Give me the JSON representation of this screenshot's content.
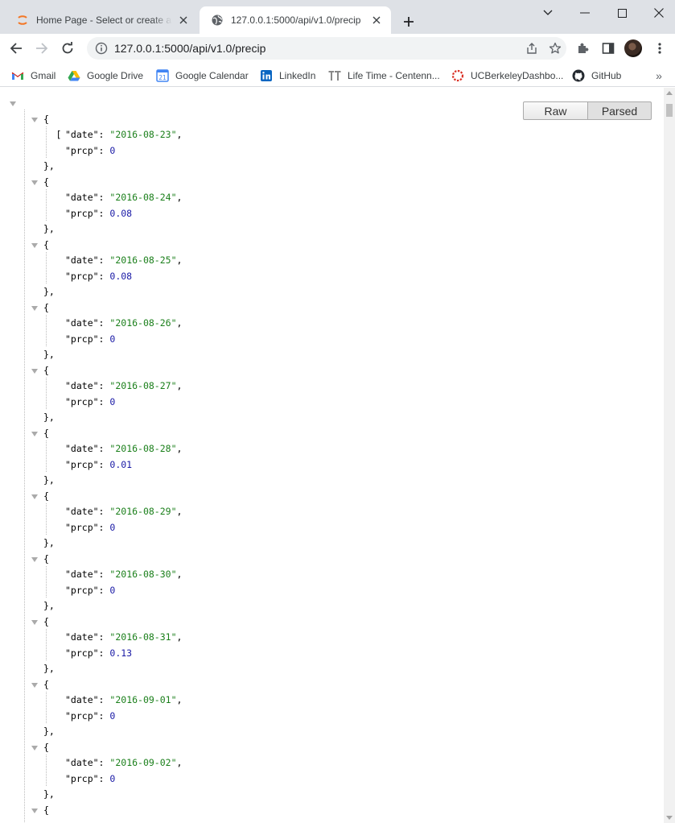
{
  "browser": {
    "tabs": [
      {
        "title": "Home Page - Select or create a notebook",
        "favicon": "jupyter-icon",
        "active": false
      },
      {
        "title": "127.0.0.1:5000/api/v1.0/precip",
        "favicon": "globe-icon",
        "active": true
      }
    ],
    "address_bar": {
      "url": "127.0.0.1:5000/api/v1.0/precip"
    },
    "bookmarks": [
      {
        "label": "Gmail",
        "icon": "gmail-icon"
      },
      {
        "label": "Google Drive",
        "icon": "google-drive-icon"
      },
      {
        "label": "Google Calendar",
        "icon": "google-calendar-icon",
        "icon_text": "21"
      },
      {
        "label": "LinkedIn",
        "icon": "linkedin-icon"
      },
      {
        "label": "Life Time - Centenn...",
        "icon": "lifetime-icon"
      },
      {
        "label": "UCBerkeleyDashbo...",
        "icon": "ucberkeley-icon"
      },
      {
        "label": "GitHub",
        "icon": "github-icon"
      }
    ],
    "bookmarks_overflow": "»"
  },
  "viewer": {
    "raw_label": "Raw",
    "parsed_label": "Parsed",
    "open_bracket": "[",
    "records": [
      {
        "date": "2016-08-23",
        "prcp": "0"
      },
      {
        "date": "2016-08-24",
        "prcp": "0.08"
      },
      {
        "date": "2016-08-25",
        "prcp": "0.08"
      },
      {
        "date": "2016-08-26",
        "prcp": "0"
      },
      {
        "date": "2016-08-27",
        "prcp": "0"
      },
      {
        "date": "2016-08-28",
        "prcp": "0.01"
      },
      {
        "date": "2016-08-29",
        "prcp": "0"
      },
      {
        "date": "2016-08-30",
        "prcp": "0"
      },
      {
        "date": "2016-08-31",
        "prcp": "0.13"
      },
      {
        "date": "2016-09-01",
        "prcp": "0"
      },
      {
        "date": "2016-09-02",
        "prcp": "0"
      }
    ]
  },
  "colors": {
    "string": "#1a7f1a",
    "number": "#1a1aa6",
    "key": "#000000"
  }
}
